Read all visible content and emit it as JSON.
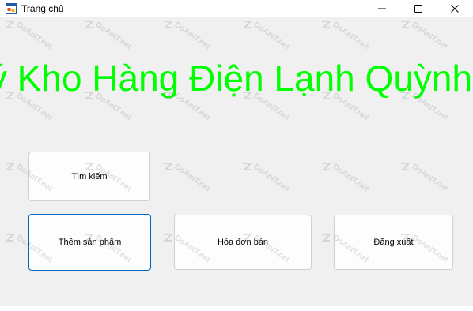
{
  "window": {
    "title": "Trang chủ",
    "controls": {
      "minimize_icon": "minimize-icon",
      "maximize_icon": "maximize-icon",
      "close_icon": "close-icon"
    }
  },
  "main": {
    "heading": "Quản Lý Kho Hàng Điện Lạnh Quỳnh Anh",
    "buttons": {
      "search": "Tìm kiếm",
      "add_product": "Thêm sản phẩm",
      "sales_invoice": "Hóa đơn bán",
      "logout": "Đăng xuất"
    }
  },
  "watermark": {
    "text": "DoAnIT.net"
  },
  "colors": {
    "heading": "#00ff00",
    "focus_border": "#0067c0",
    "background": "#f0f0f0"
  }
}
